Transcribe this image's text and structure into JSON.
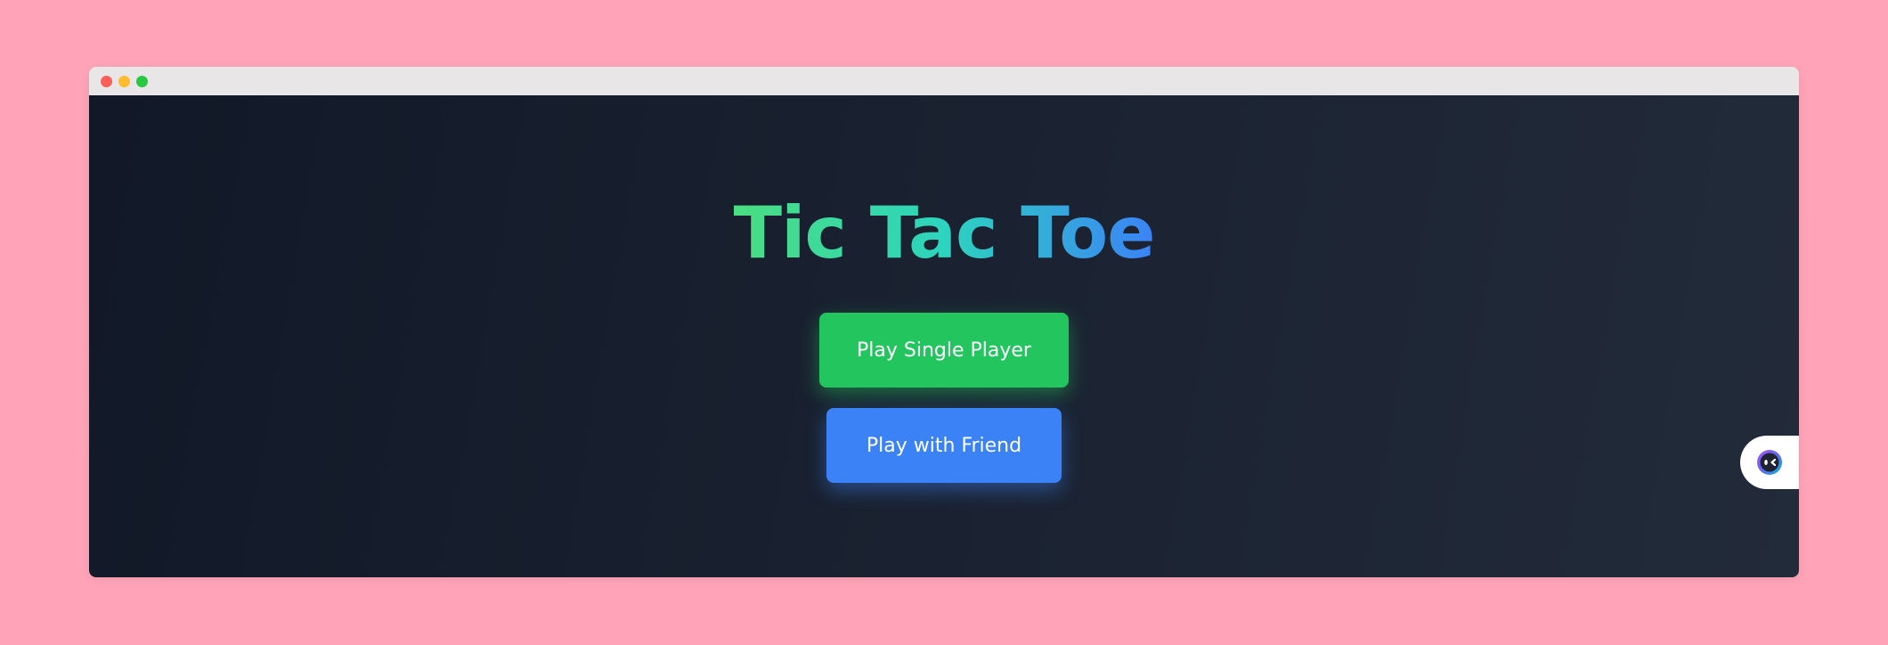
{
  "window": {
    "controls": [
      {
        "name": "close",
        "color": "#ff5f57"
      },
      {
        "name": "minimize",
        "color": "#febc2e"
      },
      {
        "name": "maximize",
        "color": "#28c840"
      }
    ]
  },
  "page": {
    "title": "Tic Tac Toe",
    "title_gradient": [
      "#4ade80",
      "#2dd4bf",
      "#3b82f6"
    ],
    "buttons": {
      "single_player": {
        "label": "Play Single Player",
        "color": "#22c55e"
      },
      "with_friend": {
        "label": "Play with Friend",
        "color": "#3b82f6"
      }
    }
  },
  "widget": {
    "icon": "assistant-face-icon"
  }
}
